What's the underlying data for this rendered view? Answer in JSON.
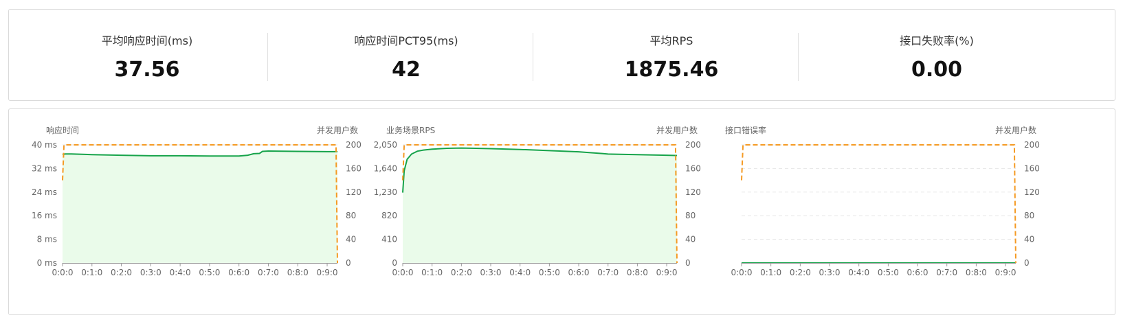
{
  "stats": [
    {
      "label": "平均响应时间(ms)",
      "value": "37.56"
    },
    {
      "label": "响应时间PCT95(ms)",
      "value": "42"
    },
    {
      "label": "平均RPS",
      "value": "1875.46"
    },
    {
      "label": "接口失败率(%)",
      "value": "0.00"
    }
  ],
  "colors": {
    "primary": "#16a34a",
    "fill": "#eafbea",
    "secondary": "#f59a23",
    "grid": "#e6e6e6",
    "axis": "#999999",
    "text": "#666666"
  },
  "chart_data": [
    {
      "type": "line",
      "left_axis_title": "响应时间",
      "right_axis_title": "并发用户数",
      "left_ticks": [
        "0 ms",
        "8 ms",
        "16 ms",
        "24 ms",
        "32 ms",
        "40 ms"
      ],
      "right_ticks": [
        "0",
        "40",
        "80",
        "120",
        "160",
        "200"
      ],
      "x_ticks": [
        "0:0:0",
        "0:1:0",
        "0:2:0",
        "0:3:0",
        "0:4:0",
        "0:5:0",
        "0:6:0",
        "0:7:0",
        "0:8:0",
        "0:9:0"
      ],
      "ylim": [
        0,
        40
      ],
      "y2lim": [
        0,
        200
      ],
      "xlim": [
        0,
        9.35
      ],
      "grid": true,
      "series": [
        {
          "axis": "left",
          "area": true,
          "x": [
            0,
            0.1,
            0.3,
            1,
            2,
            3,
            4,
            5,
            6,
            6.3,
            6.5,
            6.7,
            6.8,
            7,
            8,
            9,
            9.35
          ],
          "y": [
            36.8,
            36.9,
            36.9,
            36.7,
            36.5,
            36.3,
            36.3,
            36.2,
            36.2,
            36.5,
            37,
            37.1,
            37.8,
            37.9,
            37.8,
            37.7,
            37.7
          ]
        },
        {
          "axis": "right",
          "dashed": true,
          "x": [
            0,
            0.05,
            9.3,
            9.35
          ],
          "y": [
            140,
            200,
            200,
            0
          ]
        }
      ]
    },
    {
      "type": "line",
      "left_axis_title": "业务场景RPS",
      "right_axis_title": "并发用户数",
      "left_ticks": [
        "0",
        "410",
        "820",
        "1,230",
        "1,640",
        "2,050"
      ],
      "right_ticks": [
        "0",
        "40",
        "80",
        "120",
        "160",
        "200"
      ],
      "x_ticks": [
        "0:0:0",
        "0:1:0",
        "0:2:0",
        "0:3:0",
        "0:4:0",
        "0:5:0",
        "0:6:0",
        "0:7:0",
        "0:8:0",
        "0:9:0"
      ],
      "ylim": [
        0,
        2050
      ],
      "y2lim": [
        0,
        200
      ],
      "xlim": [
        0,
        9.35
      ],
      "grid": true,
      "series": [
        {
          "axis": "left",
          "area": true,
          "x": [
            0,
            0.05,
            0.15,
            0.3,
            0.5,
            0.7,
            1,
            1.5,
            2,
            2.5,
            3,
            4,
            5,
            6,
            6.8,
            7,
            8,
            9,
            9.35
          ],
          "y": [
            1220,
            1600,
            1800,
            1890,
            1940,
            1960,
            1975,
            1990,
            1995,
            1990,
            1985,
            1970,
            1950,
            1930,
            1900,
            1890,
            1880,
            1870,
            1865
          ]
        },
        {
          "axis": "right",
          "dashed": true,
          "x": [
            0,
            0.05,
            9.3,
            9.35
          ],
          "y": [
            140,
            200,
            200,
            0
          ]
        }
      ]
    },
    {
      "type": "line",
      "left_axis_title": "接口错误率",
      "right_axis_title": "并发用户数",
      "left_ticks": [
        "",
        "",
        "",
        "",
        "",
        ""
      ],
      "right_ticks": [
        "0",
        "40",
        "80",
        "120",
        "160",
        "200"
      ],
      "x_ticks": [
        "0:0:0",
        "0:1:0",
        "0:2:0",
        "0:3:0",
        "0:4:0",
        "0:5:0",
        "0:6:0",
        "0:7:0",
        "0:8:0",
        "0:9:0"
      ],
      "ylim": [
        0,
        1
      ],
      "y2lim": [
        0,
        200
      ],
      "xlim": [
        0,
        9.35
      ],
      "grid": true,
      "series": [
        {
          "axis": "left",
          "area": false,
          "x": [
            0,
            9.35
          ],
          "y": [
            0,
            0
          ]
        },
        {
          "axis": "right",
          "dashed": true,
          "x": [
            0,
            0.05,
            9.3,
            9.35
          ],
          "y": [
            140,
            200,
            200,
            0
          ]
        }
      ]
    }
  ]
}
